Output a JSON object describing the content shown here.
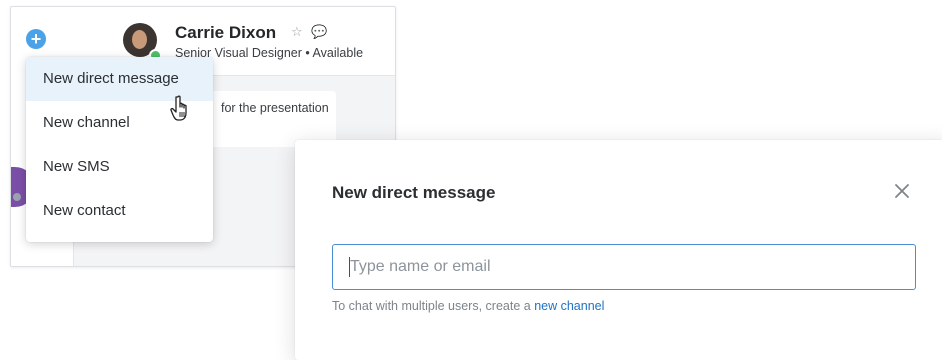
{
  "contact": {
    "name": "Carrie Dixon",
    "status": "Senior Visual Designer  •  Available"
  },
  "message_preview": "for the presentation",
  "menu": {
    "items": [
      {
        "label": "New direct message",
        "active": true
      },
      {
        "label": "New channel"
      },
      {
        "label": "New SMS"
      },
      {
        "label": "New contact"
      }
    ]
  },
  "modal": {
    "title": "New direct message",
    "input_placeholder": "Type name or email",
    "input_value": "",
    "hint_prefix": "To chat with multiple users, create a ",
    "hint_link": "new channel"
  },
  "colors": {
    "accent": "#4aa3e8",
    "link": "#1f73c2",
    "input_border": "#4a8fd3",
    "presence": "#4fbf68"
  },
  "icons": {
    "plus": "plus-icon",
    "star": "star-icon",
    "chat": "chat-icon",
    "close": "close-icon",
    "cursor": "hand-pointer-icon"
  }
}
